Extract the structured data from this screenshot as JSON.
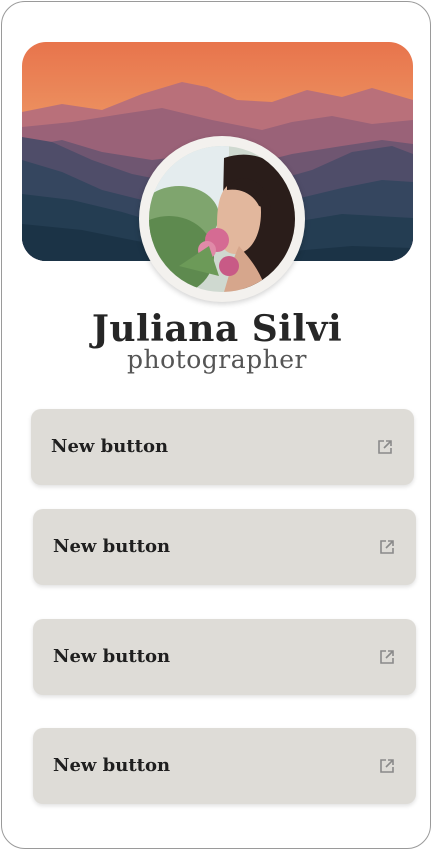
{
  "profile": {
    "name": "Juliana Silvi",
    "role": "photographer"
  },
  "buttons": [
    {
      "label": "New button",
      "icon": "external-link-icon"
    },
    {
      "label": "New button",
      "icon": "external-link-icon"
    },
    {
      "label": "New button",
      "icon": "external-link-icon"
    },
    {
      "label": "New button",
      "icon": "external-link-icon"
    }
  ],
  "colors": {
    "button_bg": "#dedcd7",
    "sky_top": "#e8764e",
    "mountain_dark": "#1d3a4f"
  }
}
